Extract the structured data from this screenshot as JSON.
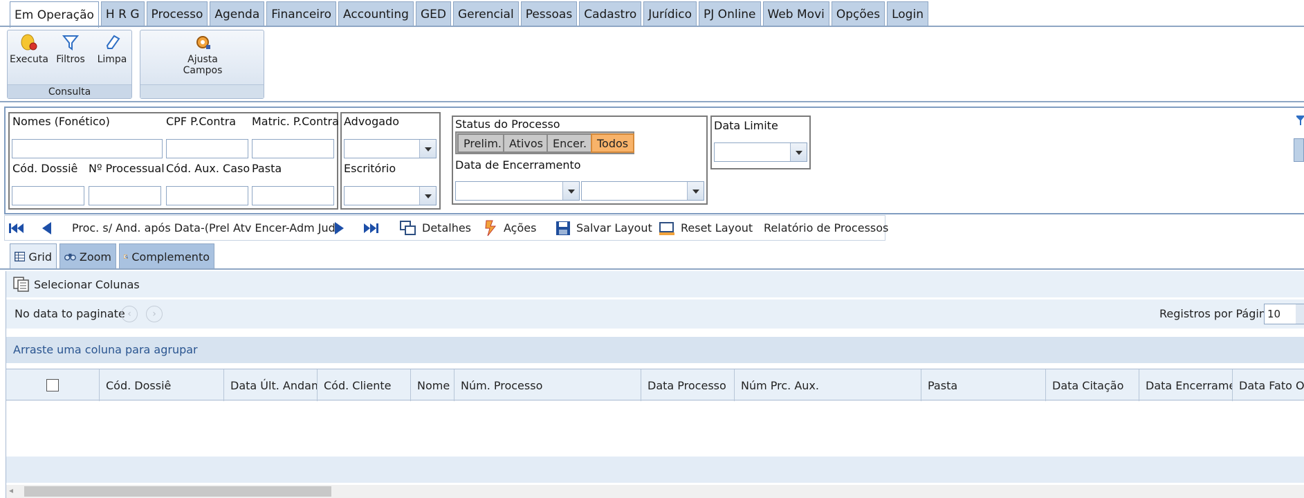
{
  "menu_tabs": [
    "Em Operação",
    "H R G",
    "Processo",
    "Agenda",
    "Financeiro",
    "Accounting",
    "GED",
    "Gerencial",
    "Pessoas",
    "Cadastro",
    "Jurídico",
    "PJ Online",
    "Web Movi",
    "Opções",
    "Login"
  ],
  "ribbon": {
    "executa": "Executa",
    "filtros": "Filtros",
    "limpa": "Limpa",
    "group_consulta": "Consulta",
    "ajusta_line1": "Ajusta",
    "ajusta_line2": "Campos"
  },
  "filters": {
    "nomes": "Nomes (Fonético)",
    "cpf": "CPF P.Contra",
    "matric": "Matric. P.Contra",
    "cod_dossie": "Cód. Dossiê",
    "num_processual": "Nº Processual",
    "cod_aux": "Cód. Aux. Caso",
    "pasta": "Pasta",
    "advogado": "Advogado",
    "escritorio": "Escritório",
    "status_title": "Status do Processo",
    "status_options": [
      "Prelim.",
      "Ativos",
      "Encer.",
      "Todos"
    ],
    "status_selected": "Todos",
    "data_encerramento": "Data de Encerramento",
    "data_limite": "Data Limite"
  },
  "actions": {
    "report_name": "Proc. s/ And. após Data-(Prel Atv Encer-Adm Jud)",
    "detalhes": "Detalhes",
    "acoes": "Ações",
    "salvar_layout": "Salvar Layout",
    "reset_layout": "Reset Layout",
    "relatorio": "Relatório de Processos"
  },
  "view_tabs": [
    "Grid",
    "Zoom",
    "Complemento"
  ],
  "grid": {
    "select_columns": "Selecionar Colunas",
    "no_data": "No data to paginate",
    "records_per_page_label": "Registros por Página",
    "records_per_page_value": "10",
    "group_hint": "Arraste uma coluna para agrupar",
    "columns": [
      "Cód. Dossiê",
      "Data Últ. Andam.",
      "Cód. Cliente",
      "Nome C",
      "Núm. Processo",
      "Data Processo",
      "Núm Prc. Aux.",
      "Pasta",
      "Data Citação",
      "Data Encerrament",
      "Data Fato Ori"
    ]
  },
  "colors": {
    "tab_bg": "#bfd1e6",
    "accent_border": "#8ea6c4",
    "status_selected": "#f8b36a",
    "grid_band": "#e8f0f8"
  }
}
